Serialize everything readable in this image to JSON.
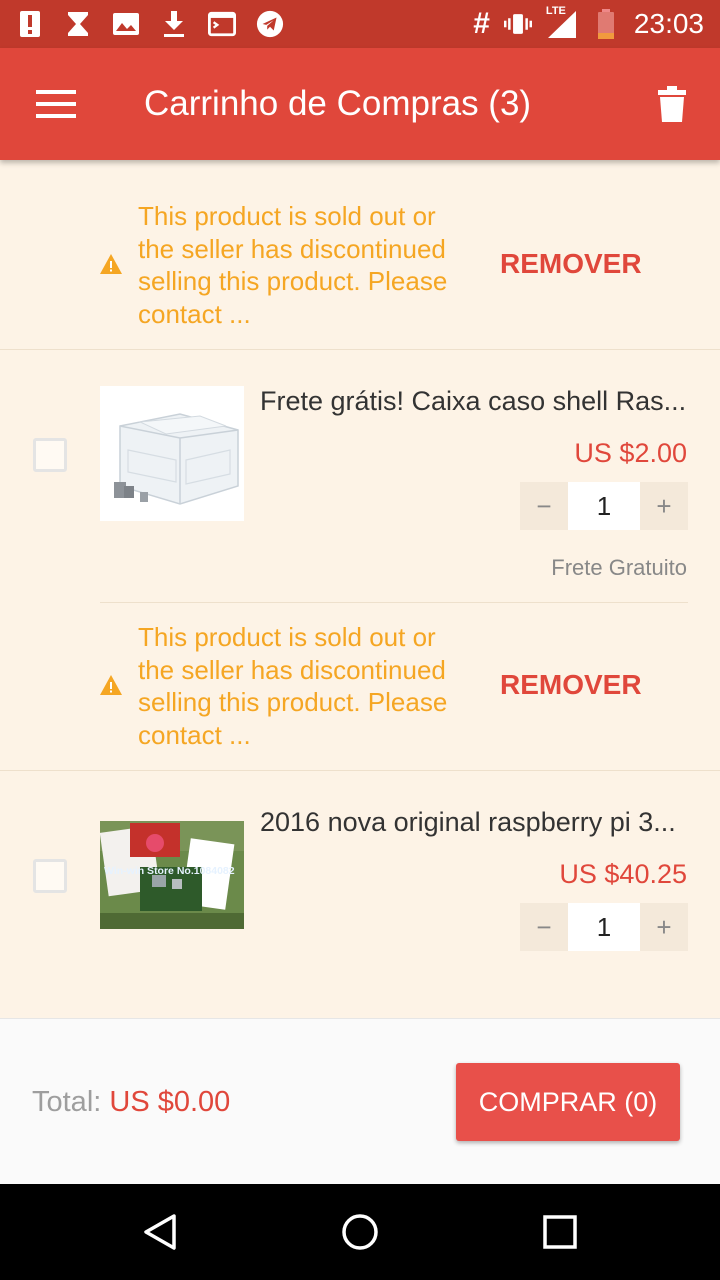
{
  "status_bar": {
    "time": "23:03",
    "hash": "#",
    "lte": "LTE",
    "icons": [
      "alert-icon",
      "hourglass-icon",
      "image-icon",
      "download-icon",
      "terminal-icon",
      "telegram-icon",
      "vibrate-icon",
      "signal-icon",
      "battery-low-icon"
    ]
  },
  "app_bar": {
    "title": "Carrinho de Compras (3)",
    "menu_icon": "menu-icon",
    "delete_icon": "trash-icon"
  },
  "cart": {
    "warnings": [
      {
        "message": "This product is sold out or the seller has discontinued selling this product. Please contact ...",
        "action": "REMOVER"
      },
      {
        "message": "This product is sold out or the seller has discontinued selling this product. Please contact ...",
        "action": "REMOVER"
      }
    ],
    "items": [
      {
        "title": "Frete grátis! Caixa caso shell Ras...",
        "price": "US $2.00",
        "quantity": "1",
        "shipping": "Frete Gratuito",
        "checked": false
      },
      {
        "title": "2016 nova original raspberry pi 3...",
        "price": "US $40.25",
        "quantity": "1",
        "shipping": "",
        "checked": false,
        "image_watermark": "Win-win Store No.1084082"
      }
    ],
    "qty_minus": "−",
    "qty_plus": "+"
  },
  "footer": {
    "total_label": "Total:",
    "total_value": "US $0.00",
    "buy_label": "COMPRAR (0)"
  },
  "colors": {
    "status_bar": "#c0392b",
    "app_bar": "#e0473b",
    "background": "#fdf3e6",
    "warning": "#f5a623",
    "accent": "#e0473b",
    "buy_button": "#e8504a"
  },
  "nav_bar": {
    "icons": [
      "back-icon",
      "home-icon",
      "recents-icon"
    ]
  }
}
